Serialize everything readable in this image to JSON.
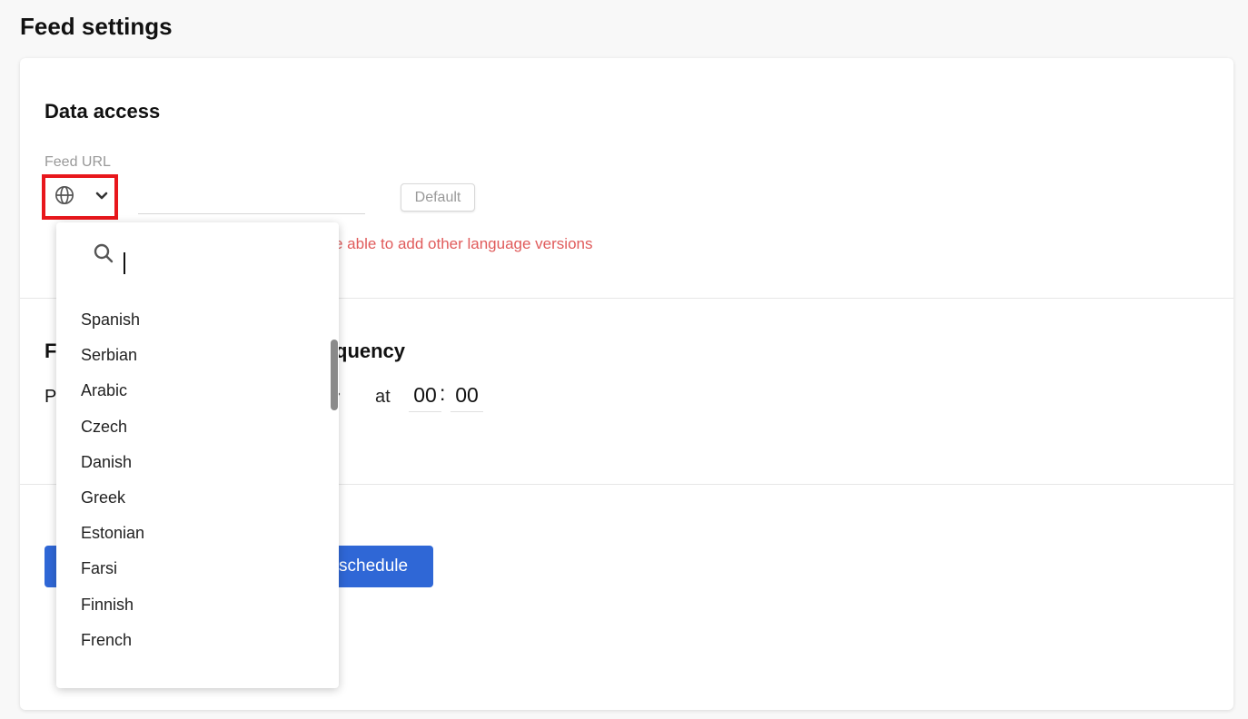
{
  "page": {
    "title": "Feed settings"
  },
  "data_access": {
    "title": "Data access",
    "feed_url_label": "Feed URL",
    "url_value": "",
    "default_button": "Default",
    "warning_visible": "e able to add other language versions"
  },
  "frequency": {
    "title_left": "F",
    "title_right": "quency",
    "period_label": "P",
    "at_label": "at",
    "hours": "00",
    "separator": ":",
    "minutes": "00"
  },
  "actions": {
    "schedule_label": "schedule"
  },
  "language_dropdown": {
    "search_value": "",
    "items": [
      "Spanish",
      "Serbian",
      "Arabic",
      "Czech",
      "Danish",
      "Greek",
      "Estonian",
      "Farsi",
      "Finnish",
      "French"
    ]
  },
  "colors": {
    "accent": "#2f67d6",
    "highlight_border": "#e8171c",
    "warning": "#e05b5b"
  },
  "icons": {
    "language_selector": "globe-icon",
    "dropdown_toggle": "chevron-down-icon",
    "search": "search-icon"
  }
}
